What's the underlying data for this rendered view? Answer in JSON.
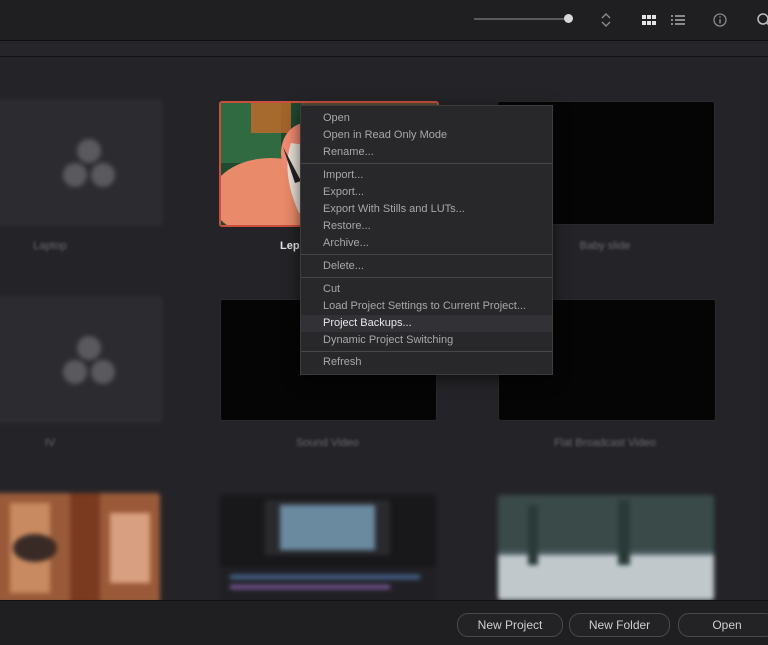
{
  "toolbar": {
    "icons": [
      "sort-icon",
      "grid-view-icon",
      "list-view-icon",
      "info-icon",
      "search-icon"
    ]
  },
  "projects": [
    {
      "label": "Laptop"
    },
    {
      "label": "Lep"
    },
    {
      "label": "Baby slide"
    },
    {
      "label": "IV"
    },
    {
      "label": "Sound Video"
    },
    {
      "label": "Flat Broadcast Video"
    }
  ],
  "context_menu": {
    "items": [
      "Open",
      "Open in Read Only Mode",
      "Rename...",
      "Import...",
      "Export...",
      "Export With Stills and LUTs...",
      "Restore...",
      "Archive...",
      "Delete...",
      "Cut",
      "Load Project Settings to Current Project...",
      "Project Backups...",
      "Dynamic Project Switching",
      "Refresh"
    ],
    "highlighted": "Project Backups..."
  },
  "bottom": {
    "new_project": "New Project",
    "new_folder": "New Folder",
    "open": "Open"
  }
}
